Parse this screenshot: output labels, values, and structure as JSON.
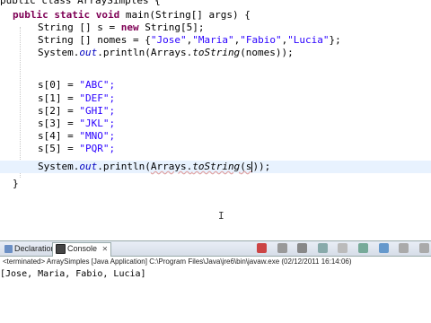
{
  "editor": {
    "line_class": "public class ArraySimples {",
    "line_main": "public static void main(String[] args) {",
    "line_decl_s": "String [] s = new String[5];",
    "line_nomes_prefix": "String [] nomes = {",
    "nomes": [
      "\"Jose\"",
      "\"Maria\"",
      "\"Fabio\"",
      "\"Lucia\""
    ],
    "line_nomes_suffix": "};",
    "println_nomes": "System.out.println(Arrays.toString(nomes));",
    "assignments": [
      {
        "lhs": "s[0] = ",
        "rhs": "\"ABC\";"
      },
      {
        "lhs": "s[1] = ",
        "rhs": "\"DEF\";"
      },
      {
        "lhs": "s[2] = ",
        "rhs": "\"GHI\";"
      },
      {
        "lhs": "s[3] = ",
        "rhs": "\"JKL\";"
      },
      {
        "lhs": "s[4] = ",
        "rhs": "\"MNO\";"
      },
      {
        "lhs": "s[5] = ",
        "rhs": "\"PQR\";"
      }
    ],
    "println_s": "System.out.println(Arrays.toString(s));",
    "close_main": "}"
  },
  "panel": {
    "tabs": [
      {
        "label": "Declaration",
        "active": false
      },
      {
        "label": "Console",
        "active": true
      }
    ],
    "launch_info": "<terminated> ArraySimples [Java Application] C:\\Program Files\\Java\\jre6\\bin\\javaw.exe (02/12/2011 16:14:06)",
    "output_line": "[Jose, Maria, Fabio, Lucia]"
  },
  "colors": {
    "keyword": "#7f0055",
    "string": "#2a00ff",
    "static_field": "#0000c0",
    "current_line": "#e8f2fe"
  }
}
